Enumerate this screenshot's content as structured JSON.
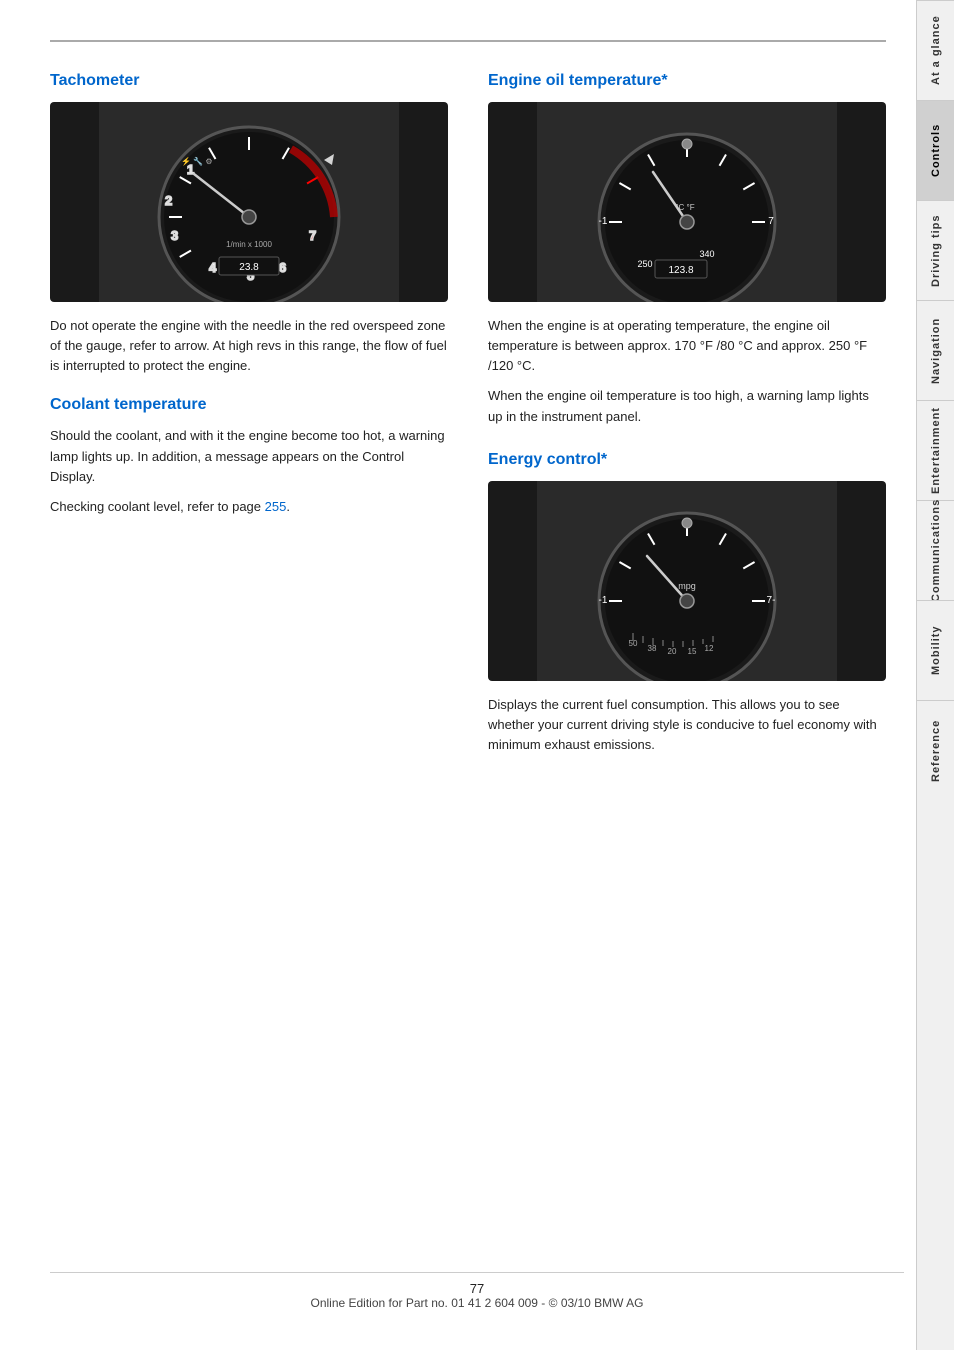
{
  "sidebar": {
    "tabs": [
      {
        "id": "at-a-glance",
        "label": "At a glance",
        "active": false
      },
      {
        "id": "controls",
        "label": "Controls",
        "active": true
      },
      {
        "id": "driving-tips",
        "label": "Driving tips",
        "active": false
      },
      {
        "id": "navigation",
        "label": "Navigation",
        "active": false
      },
      {
        "id": "entertainment",
        "label": "Entertainment",
        "active": false
      },
      {
        "id": "communications",
        "label": "Communications",
        "active": false
      },
      {
        "id": "mobility",
        "label": "Mobility",
        "active": false
      },
      {
        "id": "reference",
        "label": "Reference",
        "active": false
      }
    ]
  },
  "sections": {
    "tachometer": {
      "heading": "Tachometer",
      "body": "Do not operate the engine with the needle in the red overspeed zone of the gauge, refer to arrow. At high revs in this range, the flow of fuel is interrupted to protect the engine."
    },
    "engine_oil_temp": {
      "heading": "Engine oil temperature*",
      "paragraph1": "When the engine is at operating temperature, the engine oil temperature is between approx. 170 °F /80 °C and approx. 250 °F /120 °C.",
      "paragraph2": "When the engine oil temperature is too high, a warning lamp lights up in the instrument panel."
    },
    "coolant_temperature": {
      "heading": "Coolant temperature",
      "paragraph1": "Should the coolant, and with it the engine become too hot, a warning lamp lights up. In addition, a message appears on the Control Display.",
      "paragraph2_prefix": "Checking coolant level, refer to page ",
      "paragraph2_link": "255",
      "paragraph2_suffix": "."
    },
    "energy_control": {
      "heading": "Energy control*",
      "body": "Displays the current fuel consumption. This allows you to see whether your current driving style is conducive to fuel economy with minimum exhaust emissions."
    }
  },
  "footer": {
    "page_number": "77",
    "copyright": "Online Edition for Part no. 01 41 2 604 009 - © 03/10 BMW AG"
  }
}
